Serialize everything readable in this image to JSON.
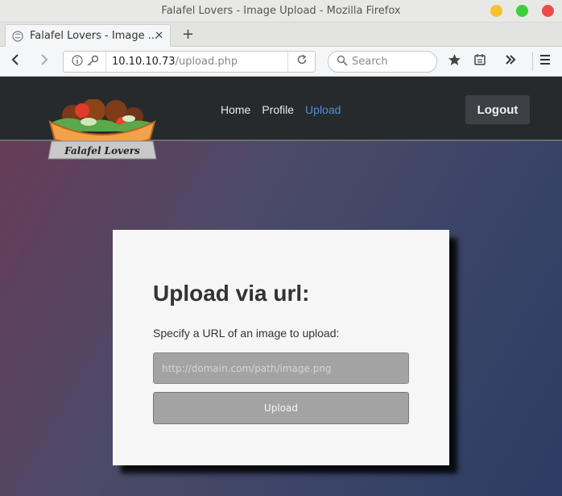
{
  "window": {
    "title": "Falafel Lovers - Image Upload - Mozilla Firefox"
  },
  "tabs": [
    {
      "label": "Falafel Lovers - Image ...",
      "active": true
    }
  ],
  "toolbar": {
    "url_host": "10.10.10.73",
    "url_path": "/upload.php",
    "search_placeholder": "Search"
  },
  "site": {
    "logo_text": "Falafel Lovers",
    "nav": [
      {
        "label": "Home",
        "active": false
      },
      {
        "label": "Profile",
        "active": false
      },
      {
        "label": "Upload",
        "active": true
      }
    ],
    "logout_label": "Logout"
  },
  "upload_form": {
    "heading": "Upload via url:",
    "instruction": "Specify a URL of an image to upload:",
    "url_placeholder": "http://domain.com/path/image.png",
    "url_value": "",
    "button_label": "Upload"
  },
  "colors": {
    "header_bg": "#272a2c",
    "nav_active": "#4e8fd8",
    "card_bg": "#f6f6f6",
    "input_bg": "#a3a3a3"
  }
}
